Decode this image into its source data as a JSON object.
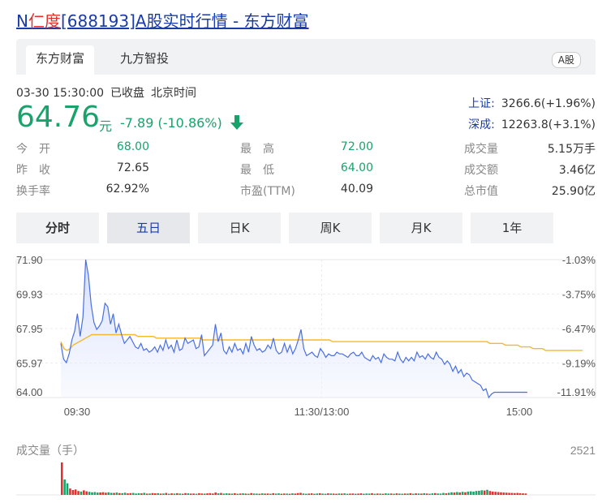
{
  "title": {
    "code_prefix": "N",
    "name": "仁度",
    "rest": "[688193]A股实时行情 - 东方财富"
  },
  "tabs": [
    {
      "label": "东方财富"
    },
    {
      "label": "九方智投"
    }
  ],
  "market_badge": "A股",
  "status": {
    "datetime": "03-30 15:30:00",
    "state": "已收盘",
    "tz": "北京时间"
  },
  "quote": {
    "price": "64.76",
    "unit": "元",
    "change": "-7.89 (-10.86%)"
  },
  "indices": [
    {
      "name": "上证:",
      "value": "3266.6(+1.96%)"
    },
    {
      "name": "深成:",
      "value": "12263.8(+3.1%)"
    }
  ],
  "stats": {
    "open": {
      "label": "今　开",
      "value": "68.00"
    },
    "prev": {
      "label": "昨　收",
      "value": "72.65"
    },
    "turnover": {
      "label": "换手率",
      "value": "62.92%"
    },
    "high": {
      "label": "最　高",
      "value": "72.00"
    },
    "low": {
      "label": "最　低",
      "value": "64.00"
    },
    "pe": {
      "label": "市盈(TTM)",
      "value": "40.09"
    },
    "volume": {
      "label": "成交量",
      "value": "5.15万手"
    },
    "amount": {
      "label": "成交额",
      "value": "3.46亿"
    },
    "mktcap": {
      "label": "总市值",
      "value": "25.90亿"
    }
  },
  "period_tabs": [
    {
      "label": "分时"
    },
    {
      "label": "五日"
    },
    {
      "label": "日K"
    },
    {
      "label": "周K"
    },
    {
      "label": "月K"
    },
    {
      "label": "1年"
    }
  ],
  "colors": {
    "up": "#e03030",
    "down": "#17a36b",
    "price_line": "#4a6fe3",
    "avg_line": "#f5b82e",
    "link": "#1a3ba8"
  },
  "chart_data": {
    "type": "line",
    "y_ticks_left": [
      "71.90",
      "69.93",
      "67.95",
      "65.97",
      "64.00"
    ],
    "y_ticks_right": [
      "-1.03%",
      "-3.75%",
      "-6.47%",
      "-9.19%",
      "-11.91%"
    ],
    "x_ticks": [
      "09:30",
      "11:30/13:00",
      "15:00"
    ],
    "ylim": [
      64.0,
      71.9
    ],
    "series": [
      {
        "role": "price",
        "values": [
          67.1,
          66.2,
          66.0,
          66.5,
          67.3,
          67.8,
          68.8,
          67.5,
          68.6,
          71.9,
          71.0,
          69.3,
          68.3,
          67.9,
          68.1,
          68.4,
          69.4,
          69.2,
          68.2,
          68.8,
          67.7,
          68.2,
          67.6,
          67.1,
          67.3,
          67.5,
          67.2,
          66.9,
          66.8,
          67.1,
          66.7,
          66.8,
          66.6,
          66.7,
          66.9,
          66.6,
          67.0,
          66.7,
          67.3,
          66.8,
          67.0,
          66.6,
          67.3,
          66.7,
          66.8,
          67.4,
          67.1,
          67.2,
          67.3,
          66.8,
          66.9,
          67.6,
          66.4,
          66.6,
          66.8,
          67.0,
          68.2,
          67.2,
          67.7,
          66.7,
          66.5,
          66.9,
          66.6,
          67.1,
          66.7,
          66.8,
          66.5,
          67.1,
          66.6,
          67.5,
          67.0,
          66.7,
          66.8,
          66.6,
          66.7,
          67.0,
          66.8,
          67.4,
          66.7,
          66.5,
          66.6,
          67.1,
          66.6,
          67.0,
          66.5,
          66.8,
          67.3,
          67.9,
          66.8,
          66.4,
          66.5,
          66.6,
          66.4,
          66.3,
          66.8,
          66.6,
          66.3,
          66.5,
          66.4,
          66.4,
          66.6,
          66.5,
          66.5,
          66.4,
          66.3,
          66.5,
          66.6,
          66.4,
          66.4,
          66.6,
          66.3,
          66.2,
          66.1,
          66.4,
          66.2,
          66.3,
          66.0,
          66.5,
          66.3,
          66.2,
          66.2,
          66.1,
          66.6,
          66.2,
          66.0,
          66.3,
          66.1,
          66.3,
          66.1,
          66.6,
          66.3,
          66.4,
          66.2,
          66.5,
          66.3,
          66.2,
          66.6,
          66.3,
          66.2,
          65.9,
          66.1,
          65.9,
          65.5,
          65.8,
          65.4,
          65.6,
          65.2,
          65.4,
          65.3,
          65.0,
          64.9,
          64.8,
          64.7,
          64.4,
          64.5,
          64.0,
          64.2,
          64.3,
          64.3,
          64.3,
          64.3,
          64.3,
          64.3,
          64.3,
          64.3,
          64.3,
          64.3,
          64.3,
          64.3,
          64.3
        ]
      },
      {
        "role": "average",
        "values": [
          67.2,
          66.8,
          66.7,
          66.8,
          67.0,
          67.1,
          67.2,
          67.3,
          67.4,
          67.5,
          67.6,
          67.6,
          67.6,
          67.6,
          67.6,
          67.6,
          67.6,
          67.6,
          67.6,
          67.6,
          67.6,
          67.6,
          67.6,
          67.6,
          67.6,
          67.5,
          67.5,
          67.5,
          67.5,
          67.5,
          67.5,
          67.4,
          67.4,
          67.4,
          67.4,
          67.4,
          67.4,
          67.4,
          67.4,
          67.4,
          67.4,
          67.4,
          67.4,
          67.4,
          67.4,
          67.4,
          67.3,
          67.3,
          67.3,
          67.3,
          67.3,
          67.3,
          67.3,
          67.3,
          67.3,
          67.3,
          67.3,
          67.3,
          67.3,
          67.3,
          67.3,
          67.3,
          67.3,
          67.3,
          67.3,
          67.3,
          67.3,
          67.3,
          67.3,
          67.3,
          67.3,
          67.3,
          67.3,
          67.3,
          67.3,
          67.3,
          67.3,
          67.3,
          67.3,
          67.3,
          67.3,
          67.3,
          67.3,
          67.3,
          67.3,
          67.3,
          67.3,
          67.3,
          67.2,
          67.2,
          67.2,
          67.2,
          67.2,
          67.2,
          67.2,
          67.2,
          67.2,
          67.2,
          67.2,
          67.2,
          67.2,
          67.2,
          67.2,
          67.2,
          67.2,
          67.2,
          67.2,
          67.2,
          67.2,
          67.2,
          67.2,
          67.2,
          67.2,
          67.2,
          67.2,
          67.2,
          67.2,
          67.2,
          67.2,
          67.2,
          67.2,
          67.2,
          67.2,
          67.2,
          67.2,
          67.2,
          67.2,
          67.2,
          67.2,
          67.2,
          67.2,
          67.2,
          67.2,
          67.2,
          67.2,
          67.2,
          67.2,
          67.2,
          67.2,
          67.1,
          67.1,
          67.1,
          67.1,
          67.1,
          67.0,
          67.0,
          67.0,
          67.0,
          67.0,
          66.9,
          66.9,
          66.9,
          66.9,
          66.8,
          66.8,
          66.8,
          66.8,
          66.7,
          66.7,
          66.7,
          66.7,
          66.7,
          66.7,
          66.7,
          66.7,
          66.7,
          66.7,
          66.7,
          66.7,
          66.7
        ]
      }
    ],
    "volume": {
      "label": "成交量（手）",
      "max_label": "2521",
      "ylim": [
        0,
        2521
      ],
      "values": [
        2521,
        1200,
        900,
        500,
        380,
        420,
        300,
        260,
        350,
        280,
        240,
        200,
        220,
        180,
        190,
        210,
        170,
        200,
        160,
        150,
        180,
        140,
        130,
        170,
        120,
        140,
        150,
        110,
        130,
        120,
        160,
        100,
        110,
        140,
        120,
        130,
        100,
        110,
        150,
        90,
        120,
        100,
        130,
        110,
        90,
        140,
        120,
        100,
        110,
        90,
        130,
        110,
        100,
        120,
        140,
        110,
        180,
        120,
        150,
        100,
        120,
        110,
        100,
        130,
        90,
        110,
        120,
        100,
        90,
        140,
        110,
        100,
        90,
        120,
        100,
        110,
        90,
        130,
        100,
        120,
        90,
        110,
        100,
        90,
        120,
        100,
        140,
        160,
        110,
        90,
        100,
        120,
        90,
        110,
        130,
        100,
        90,
        120,
        110,
        100,
        90,
        110,
        100,
        120,
        90,
        100,
        110,
        90,
        100,
        120,
        90,
        110,
        100,
        130,
        90,
        110,
        100,
        90,
        120,
        100,
        110,
        90,
        120,
        100,
        90,
        110,
        100,
        130,
        90,
        120,
        110,
        100,
        130,
        110,
        90,
        120,
        140,
        110,
        100,
        150,
        120,
        160,
        200,
        180,
        220,
        190,
        240,
        210,
        260,
        280,
        250,
        300,
        320,
        360,
        340,
        400,
        300,
        260,
        240,
        220,
        200,
        180,
        170,
        160,
        150,
        140,
        150,
        130,
        120,
        110
      ]
    }
  }
}
